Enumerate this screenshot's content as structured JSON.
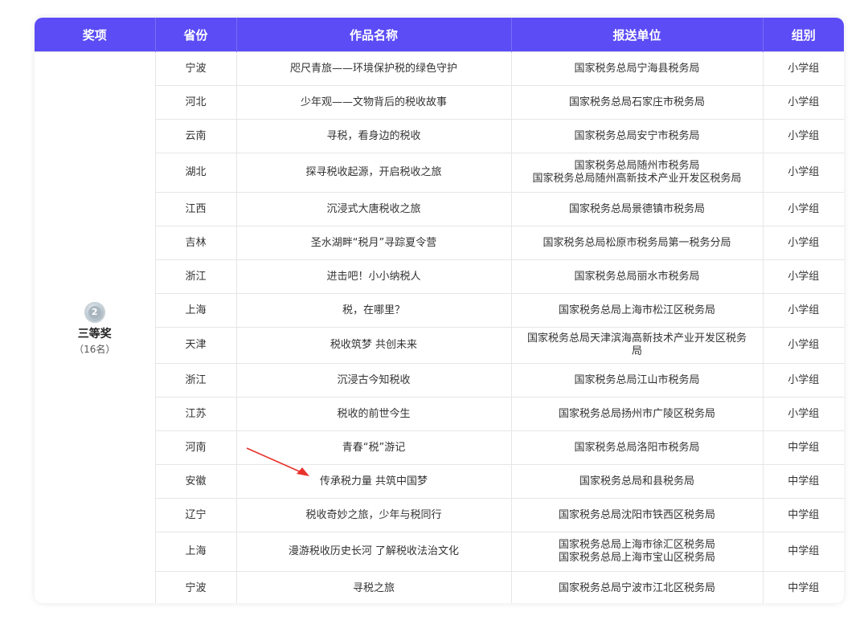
{
  "headers": {
    "award": "奖项",
    "province": "省份",
    "work": "作品名称",
    "unit": "报送单位",
    "group": "组别"
  },
  "award": {
    "medal_number": "2",
    "name": "三等奖",
    "count": "（16名）"
  },
  "rows": [
    {
      "province": "宁波",
      "work": "咫尺青旅——环境保护税的绿色守护",
      "unit": [
        "国家税务总局宁海县税务局"
      ],
      "group": "小学组"
    },
    {
      "province": "河北",
      "work": "少年观——文物背后的税收故事",
      "unit": [
        "国家税务总局石家庄市税务局"
      ],
      "group": "小学组"
    },
    {
      "province": "云南",
      "work": "寻税，看身边的税收",
      "unit": [
        "国家税务总局安宁市税务局"
      ],
      "group": "小学组"
    },
    {
      "province": "湖北",
      "work": "探寻税收起源，开启税收之旅",
      "unit": [
        "国家税务总局随州市税务局",
        "国家税务总局随州高新技术产业开发区税务局"
      ],
      "group": "小学组"
    },
    {
      "province": "江西",
      "work": "沉浸式大唐税收之旅",
      "unit": [
        "国家税务总局景德镇市税务局"
      ],
      "group": "小学组"
    },
    {
      "province": "吉林",
      "work": "圣水湖畔“税月”寻踪夏令营",
      "unit": [
        "国家税务总局松原市税务局第一税务分局"
      ],
      "group": "小学组"
    },
    {
      "province": "浙江",
      "work": "进击吧！小小纳税人",
      "unit": [
        "国家税务总局丽水市税务局"
      ],
      "group": "小学组"
    },
    {
      "province": "上海",
      "work": "税，在哪里？",
      "unit": [
        "国家税务总局上海市松江区税务局"
      ],
      "group": "小学组"
    },
    {
      "province": "天津",
      "work": "税收筑梦 共创未来",
      "unit": [
        "国家税务总局天津滨海高新技术产业开发区税务",
        "局"
      ],
      "group": "小学组"
    },
    {
      "province": "浙江",
      "work": "沉浸古今知税收",
      "unit": [
        "国家税务总局江山市税务局"
      ],
      "group": "小学组"
    },
    {
      "province": "江苏",
      "work": "税收的前世今生",
      "unit": [
        "国家税务总局扬州市广陵区税务局"
      ],
      "group": "小学组"
    },
    {
      "province": "河南",
      "work": "青春“税”游记",
      "unit": [
        "国家税务总局洛阳市税务局"
      ],
      "group": "中学组"
    },
    {
      "province": "安徽",
      "work": "传承税力量 共筑中国梦",
      "unit": [
        "国家税务总局和县税务局"
      ],
      "group": "中学组"
    },
    {
      "province": "辽宁",
      "work": "税收奇妙之旅，少年与税同行",
      "unit": [
        "国家税务总局沈阳市铁西区税务局"
      ],
      "group": "中学组"
    },
    {
      "province": "上海",
      "work": "漫游税收历史长河 了解税收法治文化",
      "unit": [
        "国家税务总局上海市徐汇区税务局",
        "国家税务总局上海市宝山区税务局"
      ],
      "group": "中学组"
    },
    {
      "province": "宁波",
      "work": "寻税之旅",
      "unit": [
        "国家税务总局宁波市江北区税务局"
      ],
      "group": "中学组"
    }
  ],
  "colors": {
    "header_bg": "#5b4cf5",
    "arrow": "#e8322b"
  }
}
